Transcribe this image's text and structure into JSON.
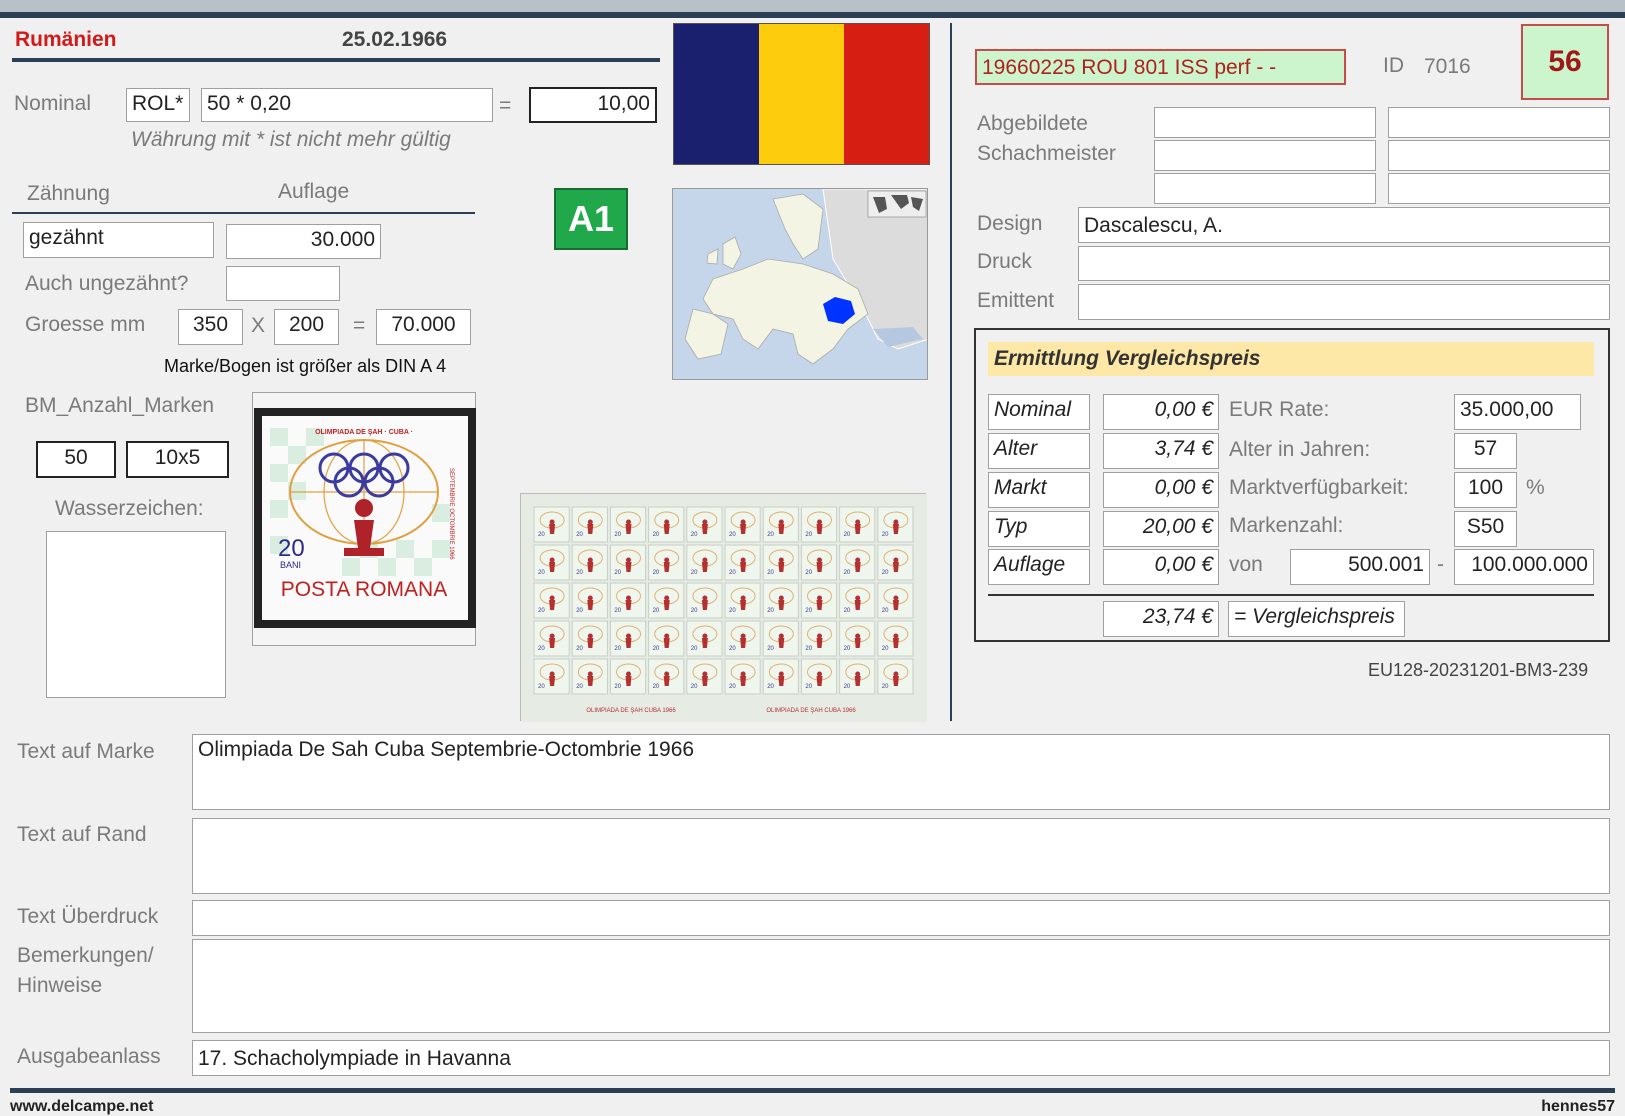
{
  "header": {
    "country": "Rumänien",
    "date": "25.02.1966"
  },
  "nominal": {
    "label": "Nominal",
    "currency": "ROL*",
    "formula": "50 * 0,20",
    "equals": "=",
    "value": "10,00",
    "currency_note": "Währung mit * ist nicht mehr gültig"
  },
  "perforation": {
    "label": "Zähnung",
    "value": "gezähnt"
  },
  "edition": {
    "label": "Auflage",
    "value": "30.000"
  },
  "imperforate": {
    "label": "Auch ungezähnt?",
    "value": ""
  },
  "size": {
    "label": "Groesse mm",
    "width": "350",
    "x": "X",
    "height": "200",
    "equals": "=",
    "area": "70.000",
    "note": "Marke/Bogen ist größer als DIN A 4"
  },
  "block": {
    "label": "BM_Anzahl_Marken",
    "count": "50",
    "layout": "10x5"
  },
  "watermark": {
    "label": "Wasserzeichen:"
  },
  "badge": {
    "text": "A1",
    "color": "#21a84a"
  },
  "flag": {
    "colors": [
      "#1a1f6e",
      "#fdcc0d",
      "#d71e12"
    ]
  },
  "stamp": {
    "header_text": "OLIMPIADA DE ŞAH · CUBA ·",
    "side_text": "SEPTEMBRIE OCTOMBRIE 1966",
    "value": "20",
    "unit": "BANI",
    "post": "POSTA ROMANA"
  },
  "sheet": {
    "footer_left": "OLIMPIADA DE ŞAH CUBA 1966",
    "footer_right": "OLIMPIADA DE ŞAH CUBA 1966"
  },
  "record": {
    "code": "19660225 ROU 801 ISS perf - -",
    "id_label": "ID",
    "id_value": "7016",
    "number": "56"
  },
  "persons": {
    "depicted_label_1": "Abgebildete",
    "depicted_label_2": "Schachmeister",
    "design_label": "Design",
    "design_value": "Dascalescu, A.",
    "print_label": "Druck",
    "print_value": "",
    "issuer_label": "Emittent",
    "issuer_value": ""
  },
  "price": {
    "title": "Ermittlung Vergleichspreis",
    "rows": [
      {
        "name": "Nominal",
        "amount": "0,00 €",
        "info_label": "EUR Rate:",
        "info_value": "35.000,00",
        "info_suffix": ""
      },
      {
        "name": "Alter",
        "amount": "3,74 €",
        "info_label": "Alter in Jahren:",
        "info_value": "57",
        "info_suffix": ""
      },
      {
        "name": "Markt",
        "amount": "0,00 €",
        "info_label": "Marktverfügbarkeit:",
        "info_value": "100",
        "info_suffix": "%"
      },
      {
        "name": "Typ",
        "amount": "20,00 €",
        "info_label": "Markenzahl:",
        "info_value": "S50",
        "info_suffix": ""
      },
      {
        "name": "Auflage",
        "amount": "0,00 €",
        "info_label": "von",
        "info_value": "500.001",
        "info_suffix": "-",
        "info_value2": "100.000.000"
      }
    ],
    "total": "23,74 €",
    "total_label": "= Vergleichspreis"
  },
  "catalog_ref": "EU128-20231201-BM3-239",
  "texts": {
    "stamp_text_label": "Text auf Marke",
    "stamp_text_value": "Olimpiada De Sah Cuba Septembrie-Octombrie 1966",
    "margin_text_label": "Text auf Rand",
    "margin_text_value": "",
    "overprint_label": "Text Überdruck",
    "overprint_value": "",
    "remarks_label_1": "Bemerkungen/",
    "remarks_label_2": "Hinweise",
    "remarks_value": "",
    "occasion_label": "Ausgabeanlass",
    "occasion_value": "17. Schacholympiade in Havanna"
  },
  "footer": {
    "left": "www.delcampe.net",
    "right": "hennes57"
  }
}
